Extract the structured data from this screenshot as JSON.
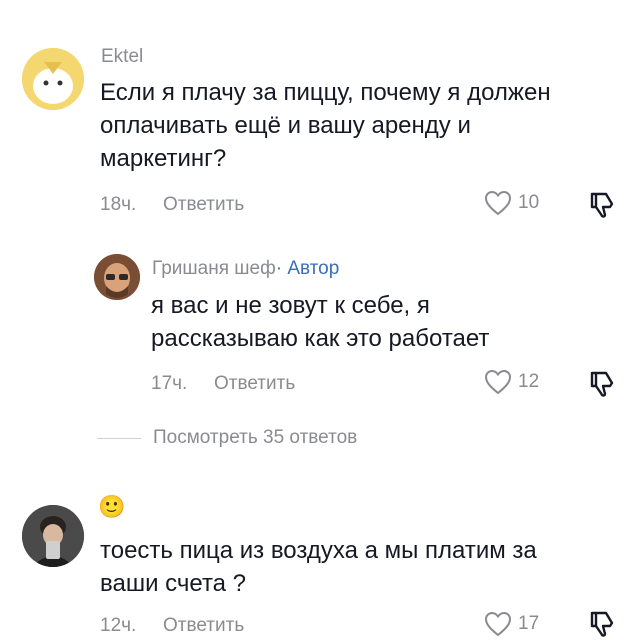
{
  "comments": [
    {
      "username": "Ektel",
      "text_lines": [
        "Если я плачу за пиццу, почему я должен",
        "оплачивать ещё и вашу аренду и",
        "маркетинг?"
      ],
      "time": "18ч.",
      "reply_label": "Ответить",
      "likes": "10"
    },
    {
      "username": "Гришаня шеф",
      "author_badge": "· Автор",
      "text_lines": [
        "я вас и не зовут к себе, я",
        "рассказываю как это работает"
      ],
      "time": "17ч.",
      "reply_label": "Ответить",
      "likes": "12"
    },
    {
      "username": "",
      "emoji": "🙂",
      "text_lines": [
        "тоесть пица из воздуха а мы платим за",
        "ваши счета ?"
      ],
      "time": "12ч.",
      "reply_label": "Ответить",
      "likes": "17"
    }
  ],
  "view_replies": "Посмотреть 35 ответов",
  "colors": {
    "text": "#161823",
    "muted": "#8a8b91",
    "author": "#3b6fb5"
  }
}
